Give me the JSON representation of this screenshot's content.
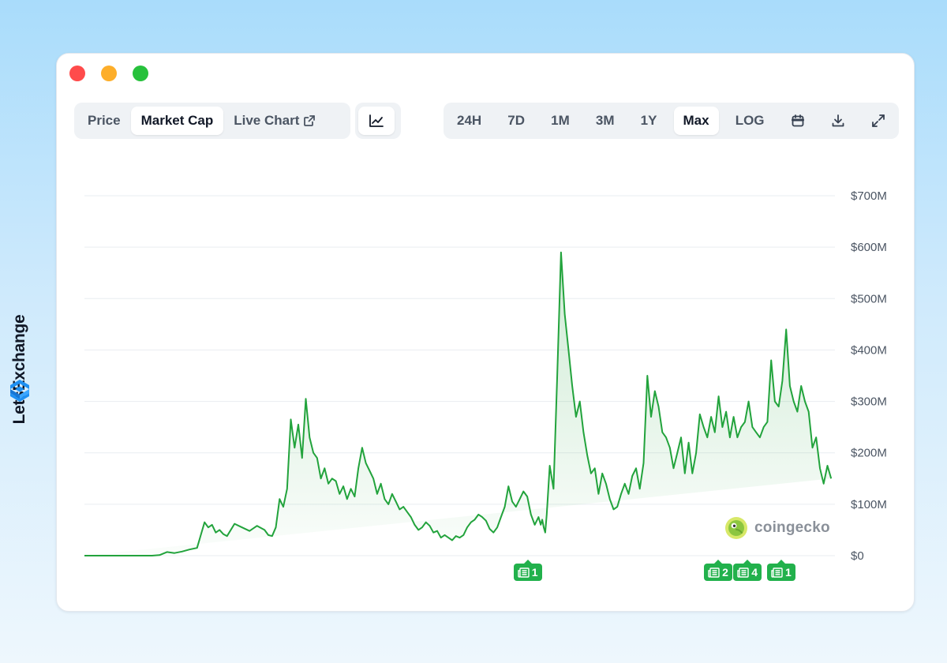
{
  "brand": {
    "name": "LetsExchange"
  },
  "tabs": [
    {
      "label": "Price",
      "active": false
    },
    {
      "label": "Market Cap",
      "active": true
    },
    {
      "label": "Live Chart",
      "active": false,
      "icon": "external-link-icon"
    }
  ],
  "chart_type_toggle": {
    "icon": "line-chart-icon"
  },
  "ranges": [
    {
      "label": "24H",
      "active": false
    },
    {
      "label": "7D",
      "active": false
    },
    {
      "label": "1M",
      "active": false
    },
    {
      "label": "3M",
      "active": false
    },
    {
      "label": "1Y",
      "active": false
    },
    {
      "label": "Max",
      "active": true
    },
    {
      "label": "LOG",
      "active": false
    }
  ],
  "tools": [
    "calendar-icon",
    "download-icon",
    "fullscreen-icon"
  ],
  "watermark": {
    "text": "coingecko"
  },
  "news_markers": [
    {
      "count": "1",
      "at": 0.5907
    },
    {
      "count": "2",
      "at": 0.8445
    },
    {
      "count": "4",
      "at": 0.8835
    },
    {
      "count": "1",
      "at": 0.9285
    }
  ],
  "colors": {
    "line": "#22a33c",
    "fill": "#22a33c",
    "news": "#22b14c",
    "accent_active": "#ffffff"
  },
  "chart_data": {
    "type": "area",
    "y_ticks": [
      "$0",
      "$100M",
      "$200M",
      "$300M",
      "$400M",
      "$500M",
      "$600M",
      "$700M"
    ],
    "ylim": [
      0,
      700
    ],
    "grid": true,
    "x": [
      0,
      0.03,
      0.06,
      0.09,
      0.1,
      0.11,
      0.12,
      0.13,
      0.14,
      0.15,
      0.16,
      0.165,
      0.17,
      0.175,
      0.18,
      0.185,
      0.19,
      0.2,
      0.21,
      0.22,
      0.23,
      0.24,
      0.245,
      0.25,
      0.255,
      0.26,
      0.265,
      0.27,
      0.275,
      0.28,
      0.285,
      0.29,
      0.295,
      0.3,
      0.305,
      0.31,
      0.315,
      0.32,
      0.325,
      0.33,
      0.335,
      0.34,
      0.345,
      0.35,
      0.355,
      0.36,
      0.365,
      0.37,
      0.375,
      0.38,
      0.385,
      0.39,
      0.395,
      0.4,
      0.405,
      0.41,
      0.415,
      0.42,
      0.425,
      0.43,
      0.435,
      0.44,
      0.445,
      0.45,
      0.455,
      0.46,
      0.465,
      0.47,
      0.475,
      0.48,
      0.485,
      0.49,
      0.495,
      0.5,
      0.505,
      0.51,
      0.515,
      0.52,
      0.525,
      0.53,
      0.535,
      0.54,
      0.545,
      0.55,
      0.555,
      0.56,
      0.565,
      0.57,
      0.575,
      0.58,
      0.585,
      0.59,
      0.595,
      0.6,
      0.605,
      0.608,
      0.61,
      0.612,
      0.614,
      0.616,
      0.62,
      0.625,
      0.63,
      0.635,
      0.64,
      0.645,
      0.65,
      0.655,
      0.66,
      0.665,
      0.67,
      0.675,
      0.68,
      0.685,
      0.69,
      0.695,
      0.7,
      0.705,
      0.71,
      0.715,
      0.72,
      0.725,
      0.73,
      0.735,
      0.74,
      0.745,
      0.75,
      0.755,
      0.76,
      0.765,
      0.77,
      0.775,
      0.78,
      0.785,
      0.79,
      0.795,
      0.8,
      0.805,
      0.81,
      0.815,
      0.82,
      0.825,
      0.83,
      0.835,
      0.84,
      0.845,
      0.85,
      0.855,
      0.86,
      0.865,
      0.87,
      0.875,
      0.88,
      0.885,
      0.89,
      0.895,
      0.9,
      0.905,
      0.91,
      0.915,
      0.92,
      0.925,
      0.93,
      0.935,
      0.94,
      0.945,
      0.95,
      0.955,
      0.96,
      0.965,
      0.97,
      0.975,
      0.98,
      0.985,
      0.99,
      0.995,
      1
    ],
    "values": [
      0,
      0,
      0,
      0,
      1,
      7,
      5,
      8,
      12,
      15,
      65,
      55,
      60,
      45,
      50,
      42,
      38,
      62,
      55,
      48,
      58,
      50,
      40,
      38,
      55,
      110,
      95,
      130,
      265,
      210,
      255,
      190,
      305,
      230,
      200,
      190,
      150,
      170,
      140,
      150,
      145,
      120,
      135,
      110,
      130,
      115,
      170,
      210,
      180,
      165,
      150,
      120,
      140,
      110,
      100,
      120,
      105,
      90,
      95,
      85,
      75,
      60,
      50,
      55,
      65,
      58,
      45,
      48,
      35,
      40,
      35,
      30,
      38,
      35,
      40,
      55,
      65,
      70,
      80,
      75,
      68,
      52,
      45,
      55,
      75,
      95,
      135,
      105,
      95,
      110,
      125,
      115,
      80,
      60,
      75,
      60,
      70,
      55,
      45,
      80,
      175,
      130,
      350,
      590,
      470,
      400,
      330,
      270,
      300,
      240,
      195,
      160,
      170,
      120,
      160,
      140,
      110,
      90,
      95,
      120,
      140,
      120,
      155,
      170,
      130,
      180,
      350,
      270,
      320,
      290,
      240,
      230,
      210,
      170,
      200,
      230,
      160,
      220,
      160,
      200,
      275,
      250,
      230,
      270,
      240,
      310,
      250,
      280,
      230,
      270,
      230,
      250,
      260,
      300,
      250,
      240,
      230,
      250,
      260,
      380,
      300,
      290,
      340,
      440,
      330,
      300,
      280,
      330,
      300,
      280,
      210,
      230,
      170,
      140,
      175,
      150
    ]
  }
}
